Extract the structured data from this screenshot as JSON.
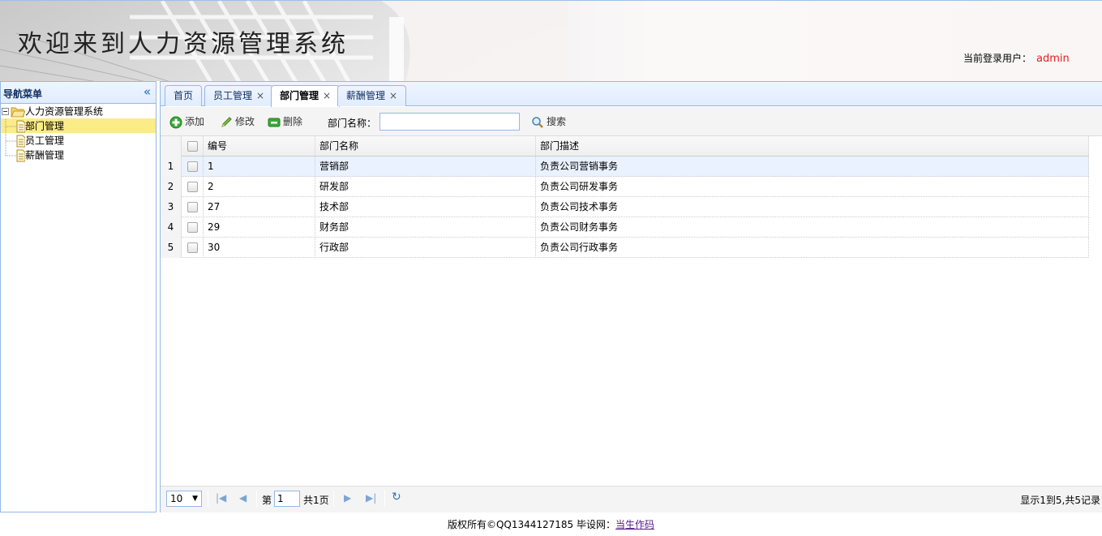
{
  "header": {
    "title": "欢迎来到人力资源管理系统",
    "login_label": "当前登录用户：",
    "login_user": "admin"
  },
  "nav": {
    "title": "导航菜单",
    "collapse_icon": "«",
    "root": "人力资源管理系统",
    "items": [
      {
        "label": "部门管理",
        "selected": true
      },
      {
        "label": "员工管理",
        "selected": false
      },
      {
        "label": "薪酬管理",
        "selected": false
      }
    ]
  },
  "tabs": [
    {
      "label": "首页",
      "closable": false
    },
    {
      "label": "员工管理",
      "closable": true
    },
    {
      "label": "部门管理",
      "closable": true,
      "active": true
    },
    {
      "label": "薪酬管理",
      "closable": true
    }
  ],
  "toolbar": {
    "add": "添加",
    "edit": "修改",
    "delete": "删除",
    "dept_name_label": "部门名称：",
    "dept_name_value": "",
    "search": "搜索"
  },
  "grid": {
    "columns": [
      "编号",
      "部门名称",
      "部门描述"
    ],
    "rows": [
      {
        "n": "1",
        "id": "1",
        "name": "营销部",
        "desc": "负责公司营销事务"
      },
      {
        "n": "2",
        "id": "2",
        "name": "研发部",
        "desc": "负责公司研发事务"
      },
      {
        "n": "3",
        "id": "27",
        "name": "技术部",
        "desc": "负责公司技术事务"
      },
      {
        "n": "4",
        "id": "29",
        "name": "财务部",
        "desc": "负责公司财务事务"
      },
      {
        "n": "5",
        "id": "30",
        "name": "行政部",
        "desc": "负责公司行政事务"
      }
    ]
  },
  "pager": {
    "page_size": "10",
    "page_prefix": "第",
    "page": "1",
    "page_total": "共1页",
    "info": "显示1到5,共5记录"
  },
  "footer": {
    "text": "版权所有©QQ1344127185 毕设网：",
    "link": "当生作码"
  }
}
